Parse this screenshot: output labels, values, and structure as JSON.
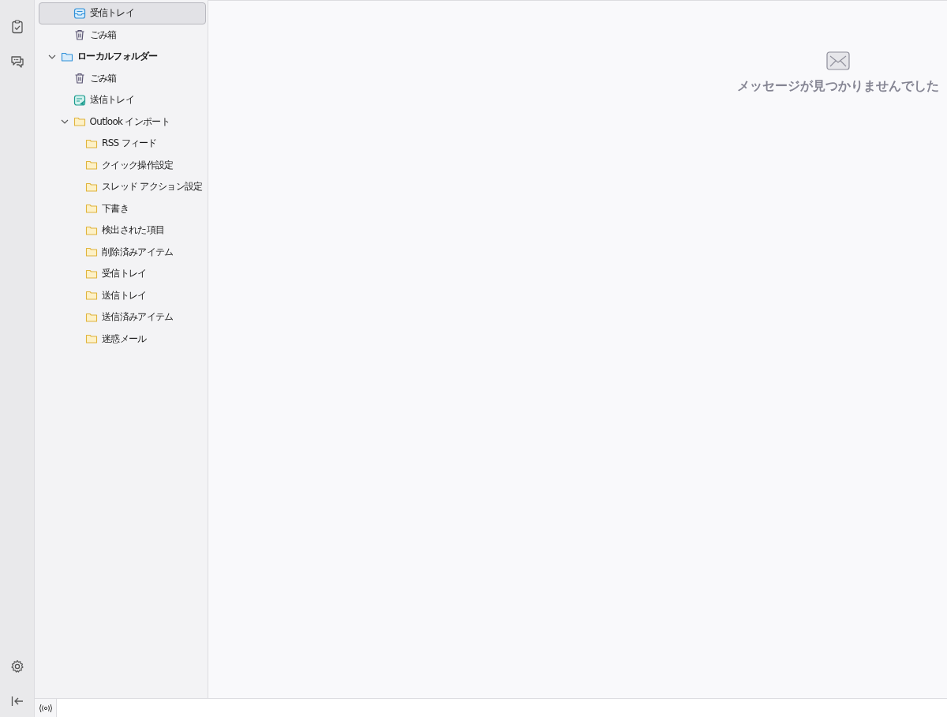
{
  "upper_folders": [
    {
      "kind": "inbox",
      "label": "受信トレイ",
      "selected": true
    },
    {
      "kind": "trash",
      "label": "ごみ箱",
      "selected": false
    }
  ],
  "tree": [
    {
      "kind": "account",
      "label": "ローカルフォルダー",
      "selected": false,
      "expanded": true,
      "children": [
        {
          "kind": "trash",
          "label": "ごみ箱",
          "selected": false
        },
        {
          "kind": "outbox",
          "label": "送信トレイ",
          "selected": false
        },
        {
          "kind": "folder",
          "label": "Outlook インポート",
          "selected": false,
          "expanded": true,
          "children": [
            {
              "kind": "folder",
              "label": "RSS フィード",
              "selected": false
            },
            {
              "kind": "folder",
              "label": "クイック操作設定",
              "selected": false
            },
            {
              "kind": "folder",
              "label": "スレッド アクション設定",
              "selected": false
            },
            {
              "kind": "folder",
              "label": "下書き",
              "selected": false
            },
            {
              "kind": "folder",
              "label": "検出された項目",
              "selected": false
            },
            {
              "kind": "folder",
              "label": "削除済みアイテム",
              "selected": false
            },
            {
              "kind": "folder",
              "label": "受信トレイ",
              "selected": false
            },
            {
              "kind": "folder",
              "label": "送信トレイ",
              "selected": false
            },
            {
              "kind": "folder",
              "label": "送信済みアイテム",
              "selected": false
            },
            {
              "kind": "folder",
              "label": "迷惑メール",
              "selected": false
            }
          ]
        }
      ]
    }
  ],
  "empty_message": "メッセージが見つかりませんでした"
}
